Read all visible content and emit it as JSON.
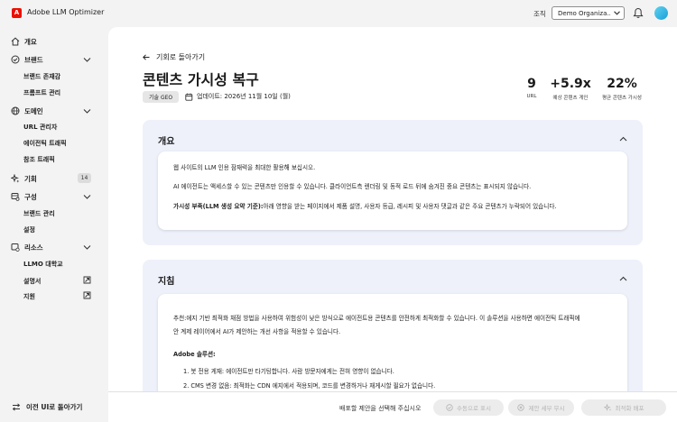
{
  "header": {
    "app_title": "Adobe LLM Optimizer",
    "org_label": "조직",
    "org_value": "Demo Organiza...",
    "icons": [
      "adobe-logo",
      "chevron-down-icon",
      "bell-icon",
      "avatar"
    ]
  },
  "sidebar": {
    "items": [
      {
        "label": "개요",
        "icon": "home-icon"
      },
      {
        "label": "브랜드",
        "icon": "check-circle-icon"
      },
      {
        "label": "브랜드 존재감"
      },
      {
        "label": "프롬프트 관리"
      },
      {
        "label": "도메인",
        "icon": "globe-icon"
      },
      {
        "label": "URL 관리자"
      },
      {
        "label": "에이전틱 트래픽"
      },
      {
        "label": "참조 트래픽"
      },
      {
        "label": "기회",
        "icon": "sparkle-icon",
        "badge": "14"
      },
      {
        "label": "구성",
        "icon": "config-icon"
      },
      {
        "label": "브랜드 관리"
      },
      {
        "label": "설정"
      },
      {
        "label": "리소스",
        "icon": "resources-icon"
      },
      {
        "label": "LLMO 대학교"
      },
      {
        "label": "설명서"
      },
      {
        "label": "지원"
      }
    ],
    "back_old_ui": "이전 UI로 돌아가기"
  },
  "main": {
    "back_label": "기회로 돌아가기",
    "title": "콘텐츠 가시성 복구",
    "tag": "기술 GEO",
    "updated": "업데이트: 2026년 11월 10일 (월)",
    "stats": [
      {
        "value": "9",
        "label": "URL"
      },
      {
        "value": "+5.9x",
        "label": "예상 콘텐츠 게인"
      },
      {
        "value": "22%",
        "label": "평균 콘텐츠 가시성"
      }
    ],
    "overview": {
      "heading": "개요",
      "line1": "웹 사이트의 LLM 인용 잠재력을 최대한 활용해 보십시오.",
      "line2": "AI 에이전트는 액세스할 수 있는 콘텐츠만 인용할 수 있습니다. 클라이언트측 렌더링 및 동적 로드 뒤에 숨겨진 중요 콘텐츠는 표시되지 않습니다.",
      "line3_bold": "가시성 부족(LLM 생성 요약 기준):",
      "line3_rest": "아래 영향을 받는 페이지에서 제품 설명, 사용자 등급, 레시피 및 사용자 댓글과 같은 주요 콘텐츠가 누락되어 있습니다."
    },
    "guidance": {
      "heading": "지침",
      "line1": "추천:에지 기반 최적화 채점 방법을 사용하여 위험성이 낮은 방식으로 에이전트용 콘텐츠를 안전하게 최적화할 수 있습니다. 이 솔루션을 사용하면 에이전틱 트래픽에",
      "line2": "안 계제 레이어에서 AI가 제안하는 개선 사항을 적용할 수 있습니다.",
      "solution_heading": "Adobe 솔루션:",
      "step1": "1. 봇 전용 게재: 에이전트만 타기팅합니다. 사람 방문자에게는 전혀 영향이 없습니다.",
      "step2": "2. CMS 변경 없음: 최적화는 CDN 에지에서 적용되며, 코드를 변경하거나 재게시할 필요가 없습니다."
    }
  },
  "footer": {
    "hint": "배포할 제안을 선택해 주십시오",
    "buttons": [
      "수동으로 표시",
      "제안 세부 무시",
      "최적화 배포"
    ]
  }
}
